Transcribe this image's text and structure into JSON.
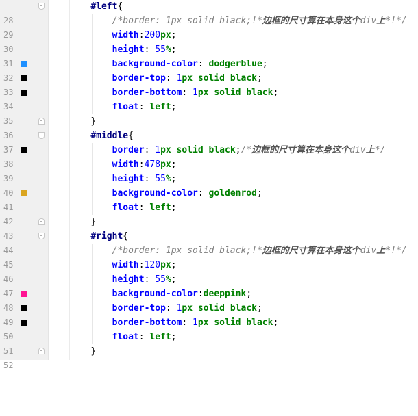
{
  "gutter": {
    "lines": [
      "28",
      "29",
      "30",
      "31",
      "32",
      "33",
      "34",
      "35",
      "36",
      "37",
      "38",
      "39",
      "40",
      "41",
      "42",
      "43",
      "44",
      "45",
      "46",
      "47",
      "48",
      "49",
      "50",
      "51",
      "52"
    ]
  },
  "swatches": {
    "dodgerblue": "#1e90ff",
    "black": "#000000",
    "goldenrod": "#daa520",
    "deeppink": "#ff1493"
  },
  "code": {
    "l28": {
      "sel": "#left",
      "brace": "{"
    },
    "l29": {
      "c1": "/*border: 1px solid black;!*",
      "c2": "边框的尺寸算在本身这个",
      "c3": "div",
      "c4": "上",
      "c5": "*!*/"
    },
    "l30": {
      "prop": "width",
      "colon": ":",
      "num": "200",
      "unit": "px",
      "semi": ";"
    },
    "l31": {
      "prop": "height",
      "colon": ": ",
      "num": "55",
      "unit": "%",
      "semi": ";"
    },
    "l32": {
      "prop": "background-color",
      "colon": ": ",
      "val": "dodgerblue",
      "semi": ";"
    },
    "l33": {
      "prop": "border-top",
      "colon": ": ",
      "num": "1",
      "unit": "px",
      "val": " solid black",
      "semi": ";"
    },
    "l34": {
      "prop": "border-bottom",
      "colon": ": ",
      "num": "1",
      "unit": "px",
      "val": " solid black",
      "semi": ";"
    },
    "l35": {
      "prop": "float",
      "colon": ": ",
      "val": "left",
      "semi": ";"
    },
    "l36": {
      "brace": "}"
    },
    "l37": {
      "sel": "#middle",
      "brace": "{"
    },
    "l38": {
      "prop": "border",
      "colon": ": ",
      "num": "1",
      "unit": "px",
      "val": " solid black",
      "semi": ";",
      "c1": "/*",
      "c2": "边框的尺寸算在本身这个",
      "c3": "div",
      "c4": "上",
      "c5": "*/"
    },
    "l39": {
      "prop": "width",
      "colon": ":",
      "num": "478",
      "unit": "px",
      "semi": ";"
    },
    "l40": {
      "prop": "height",
      "colon": ": ",
      "num": "55",
      "unit": "%",
      "semi": ";"
    },
    "l41": {
      "prop": "background-color",
      "colon": ": ",
      "val": "goldenrod",
      "semi": ";"
    },
    "l42": {
      "prop": "float",
      "colon": ": ",
      "val": "left",
      "semi": ";"
    },
    "l43": {
      "brace": "}"
    },
    "l44": {
      "sel": "#right",
      "brace": "{"
    },
    "l45": {
      "c1": "/*border: 1px solid black;!*",
      "c2": "边框的尺寸算在本身这个",
      "c3": "div",
      "c4": "上",
      "c5": "*!*/"
    },
    "l46": {
      "prop": "width",
      "colon": ":",
      "num": "120",
      "unit": "px",
      "semi": ";"
    },
    "l47": {
      "prop": "height",
      "colon": ": ",
      "num": "55",
      "unit": "%",
      "semi": ";"
    },
    "l48": {
      "prop": "background-color",
      "colon": ":",
      "val": "deeppink",
      "semi": ";"
    },
    "l49": {
      "prop": "border-top",
      "colon": ": ",
      "num": "1",
      "unit": "px",
      "val": " solid black",
      "semi": ";"
    },
    "l50": {
      "prop": "border-bottom",
      "colon": ": ",
      "num": "1",
      "unit": "px",
      "val": " solid black",
      "semi": ";"
    },
    "l51": {
      "prop": "float",
      "colon": ": ",
      "val": "left",
      "semi": ";"
    },
    "l52": {
      "brace": "}"
    }
  }
}
